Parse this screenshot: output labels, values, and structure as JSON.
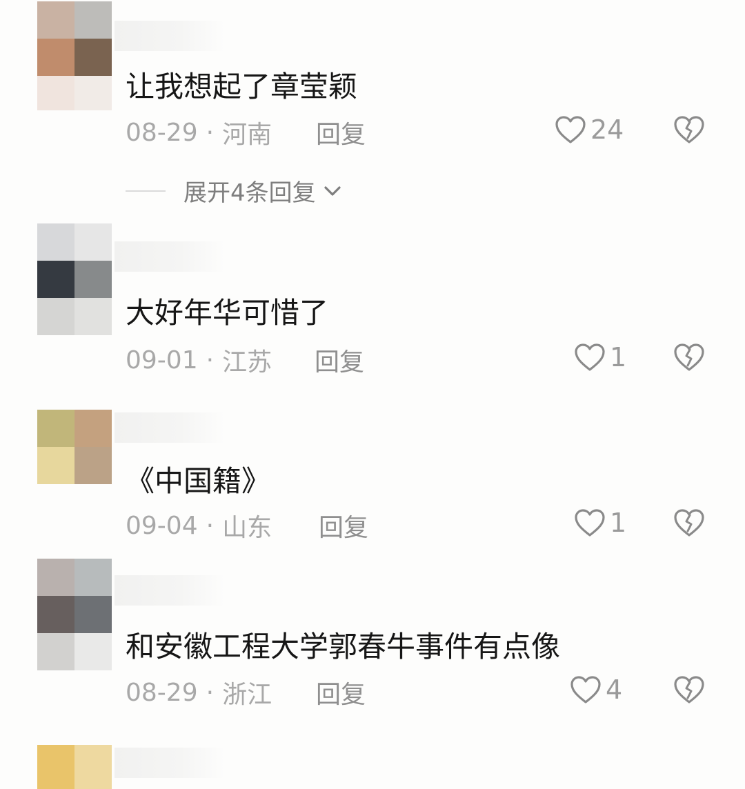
{
  "comments": [
    {
      "text": "让我想起了章莹颖",
      "date": "08-29",
      "location": "河南",
      "reply_label": "回复",
      "likes": "24",
      "expand_label": "展开4条回复"
    },
    {
      "text": "大好年华可惜了",
      "date": "09-01",
      "location": "江苏",
      "reply_label": "回复",
      "likes": "1"
    },
    {
      "text": "《中国籍》",
      "date": "09-04",
      "location": "山东",
      "reply_label": "回复",
      "likes": "1"
    },
    {
      "text": "和安徽工程大学郭春牛事件有点像",
      "date": "08-29",
      "location": "浙江",
      "reply_label": "回复",
      "likes": "4"
    }
  ],
  "meta_separator": "·",
  "icons": {
    "like": "heart-outline-icon",
    "dislike": "broken-heart-icon",
    "expand": "chevron-down-icon"
  },
  "colors": {
    "text": "#161616",
    "meta": "#a8a8a8",
    "icon": "#8a8a8a"
  }
}
